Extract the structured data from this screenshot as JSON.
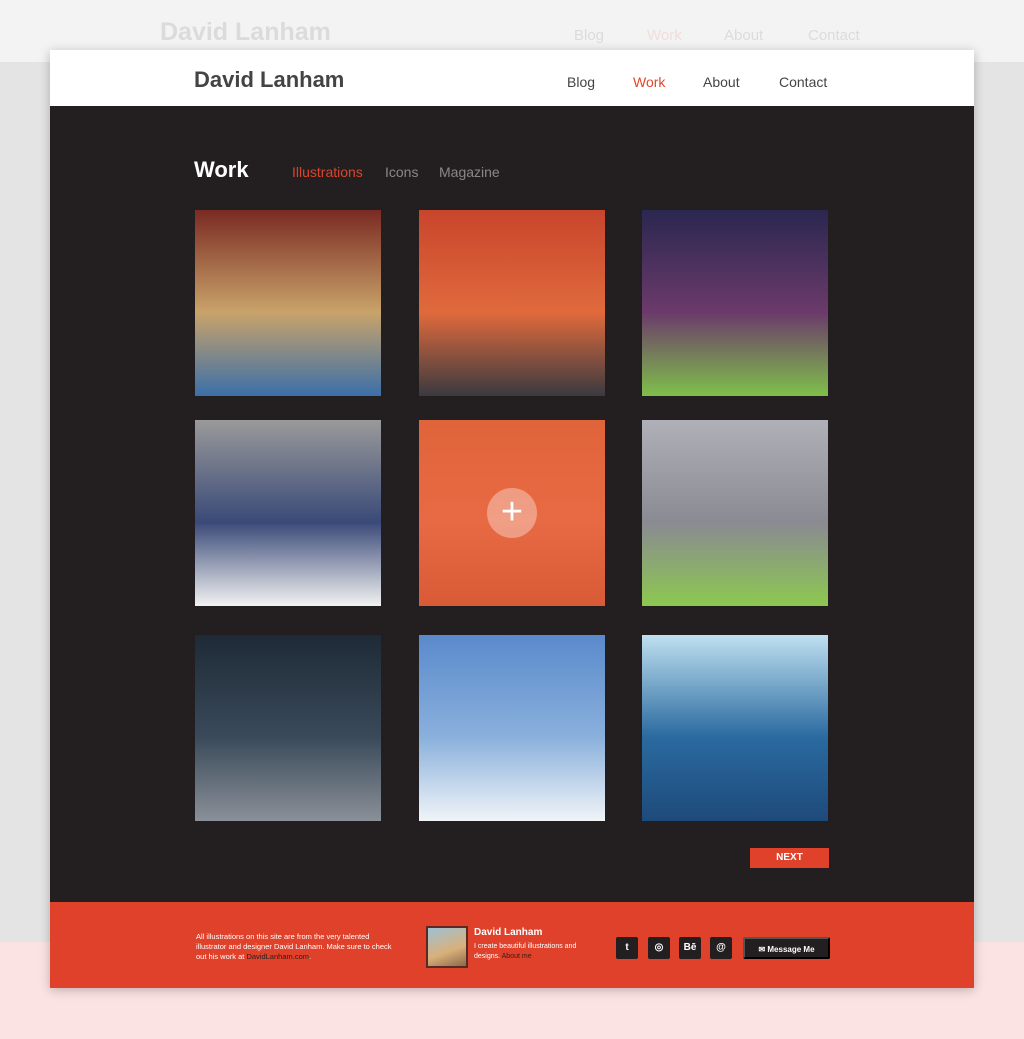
{
  "site": {
    "title": "David Lanham"
  },
  "nav": [
    {
      "label": "Blog"
    },
    {
      "label": "Work",
      "active": true
    },
    {
      "label": "About"
    },
    {
      "label": "Contact"
    }
  ],
  "work": {
    "title": "Work",
    "tabs": [
      {
        "label": "Illustrations",
        "active": true
      },
      {
        "label": "Icons"
      },
      {
        "label": "Magazine"
      }
    ]
  },
  "gallery": [
    {
      "colors": [
        "#7a2a22",
        "#c9a36a",
        "#3b6fa8"
      ]
    },
    {
      "colors": [
        "#c8452c",
        "#e06a3c",
        "#3a3a40"
      ]
    },
    {
      "colors": [
        "#2a2750",
        "#6b3a6a",
        "#7fbf4a"
      ]
    },
    {
      "colors": [
        "#9a9a9a",
        "#3a4a78",
        "#f2f2f2"
      ]
    },
    {
      "colors": [
        "#e0643a",
        "#e86a44",
        "#d85a36"
      ],
      "hovered": true,
      "overlay_icon": "plus-icon"
    },
    {
      "colors": [
        "#b0b0b8",
        "#8a8a92",
        "#8cc850"
      ]
    },
    {
      "colors": [
        "#1e2a36",
        "#3a4a5a",
        "#8a9098"
      ]
    },
    {
      "colors": [
        "#5a8acc",
        "#8ab0dc",
        "#f0f4f8"
      ]
    },
    {
      "colors": [
        "#bfe0f0",
        "#2a6aa0",
        "#1e4a7a"
      ]
    }
  ],
  "pagination": {
    "next_label": "NEXT"
  },
  "footer": {
    "credit_text": "All illustrations on this site are from the very talented illustrator and designer David Lanham. Make sure to check out his work at ",
    "credit_link": "DavidLanham.com",
    "credit_end": ".",
    "profile_name": "David Lanham",
    "profile_bio": "I create beautiful illustrations and designs. ",
    "profile_link": "About me",
    "social": [
      {
        "icon": "twitter-icon",
        "glyph": "t"
      },
      {
        "icon": "dribbble-icon",
        "glyph": "◎"
      },
      {
        "icon": "behance-icon",
        "glyph": "Bē"
      },
      {
        "icon": "email-at-icon",
        "glyph": "@"
      }
    ],
    "message_label": "Message Me"
  },
  "colors": {
    "accent": "#e0412a",
    "dark": "#231f20"
  }
}
